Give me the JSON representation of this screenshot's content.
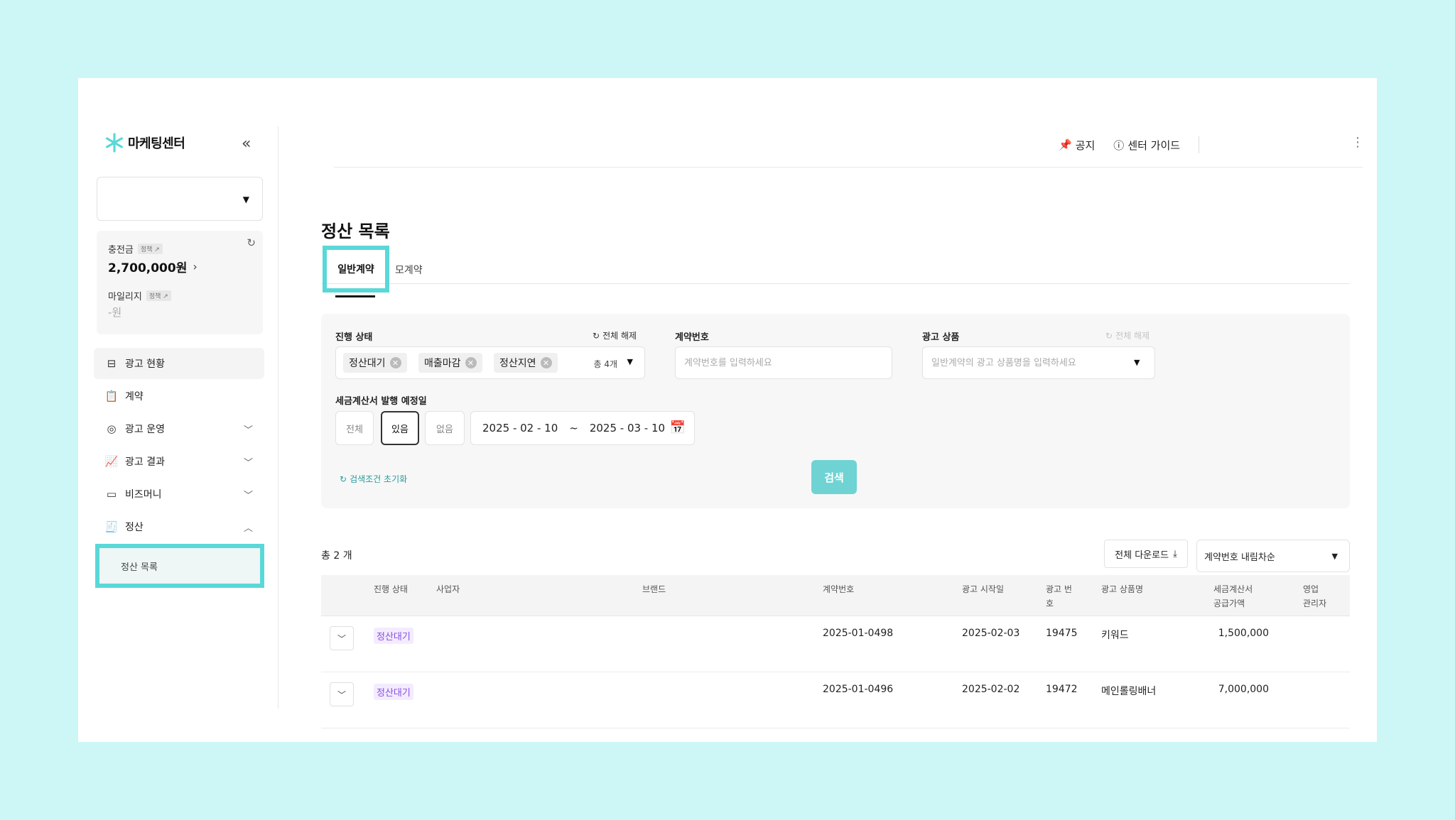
{
  "brand": {
    "title": "마케팅센터",
    "logo_color": "#5ad8d8"
  },
  "sidebar": {
    "wallet": {
      "charge_label": "충전금",
      "charge_tag": "정책 ↗",
      "charge_amount": "2,700,000원",
      "mileage_label": "마일리지",
      "mileage_tag": "정책 ↗",
      "mileage_amount": "-원"
    },
    "nav": [
      {
        "label": "광고 현황",
        "icon": "ad-status-icon"
      },
      {
        "label": "계약",
        "icon": "contract-icon"
      },
      {
        "label": "광고 운영",
        "icon": "ad-operation-icon"
      },
      {
        "label": "광고 결과",
        "icon": "ad-result-icon"
      },
      {
        "label": "비즈머니",
        "icon": "wallet-icon"
      },
      {
        "label": "정산",
        "icon": "settlement-icon"
      }
    ],
    "sub_item": "정산 목록"
  },
  "topbar": {
    "notice": "공지",
    "guide": "센터 가이드"
  },
  "page": {
    "title": "정산 목록",
    "tabs": [
      "일반계약",
      "모계약"
    ]
  },
  "filter": {
    "status_label": "진행 상태",
    "reset_all": "전체 해제",
    "chips": [
      "정산대기",
      "매출마감",
      "정산지연"
    ],
    "chip_count": "총 4개",
    "contract_label": "계약번호",
    "contract_placeholder": "계약번호를 입력하세요",
    "product_label": "광고 상품",
    "product_reset": "전체 해제",
    "product_placeholder": "일반계약의 광고 상품명을 입력하세요",
    "invoice_label": "세금계산서 발행 예정일",
    "segments": [
      "전체",
      "있음",
      "없음"
    ],
    "date_from": "2025 - 02 - 10",
    "date_sep": "~",
    "date_to": "2025 - 03 - 10",
    "reset_search": "검색조건 초기화",
    "search_button": "검색",
    "accent_color": "#6fd3d3"
  },
  "list": {
    "total": "총 2 개",
    "download_all": "전체 다운로드",
    "sort": "계약번호 내림차순",
    "columns": {
      "status": "진행 상태",
      "business": "사업자",
      "brand": "브랜드",
      "contract_no": "계약번호",
      "start_date": "광고 시작일",
      "ad_no_1": "광고 번",
      "ad_no_2": "호",
      "product": "광고 상품명",
      "invoice_1": "세금계산서",
      "invoice_2": "공급가액",
      "manager_1": "영업",
      "manager_2": "관리자"
    },
    "rows": [
      {
        "status": "정산대기",
        "contract_no": "2025-01-0498",
        "start_date": "2025-02-03",
        "ad_no": "19475",
        "product": "키워드",
        "amount": "1,500,000"
      },
      {
        "status": "정산대기",
        "contract_no": "2025-01-0496",
        "start_date": "2025-02-02",
        "ad_no": "19472",
        "product": "메인롤링배너",
        "amount": "7,000,000"
      }
    ]
  }
}
